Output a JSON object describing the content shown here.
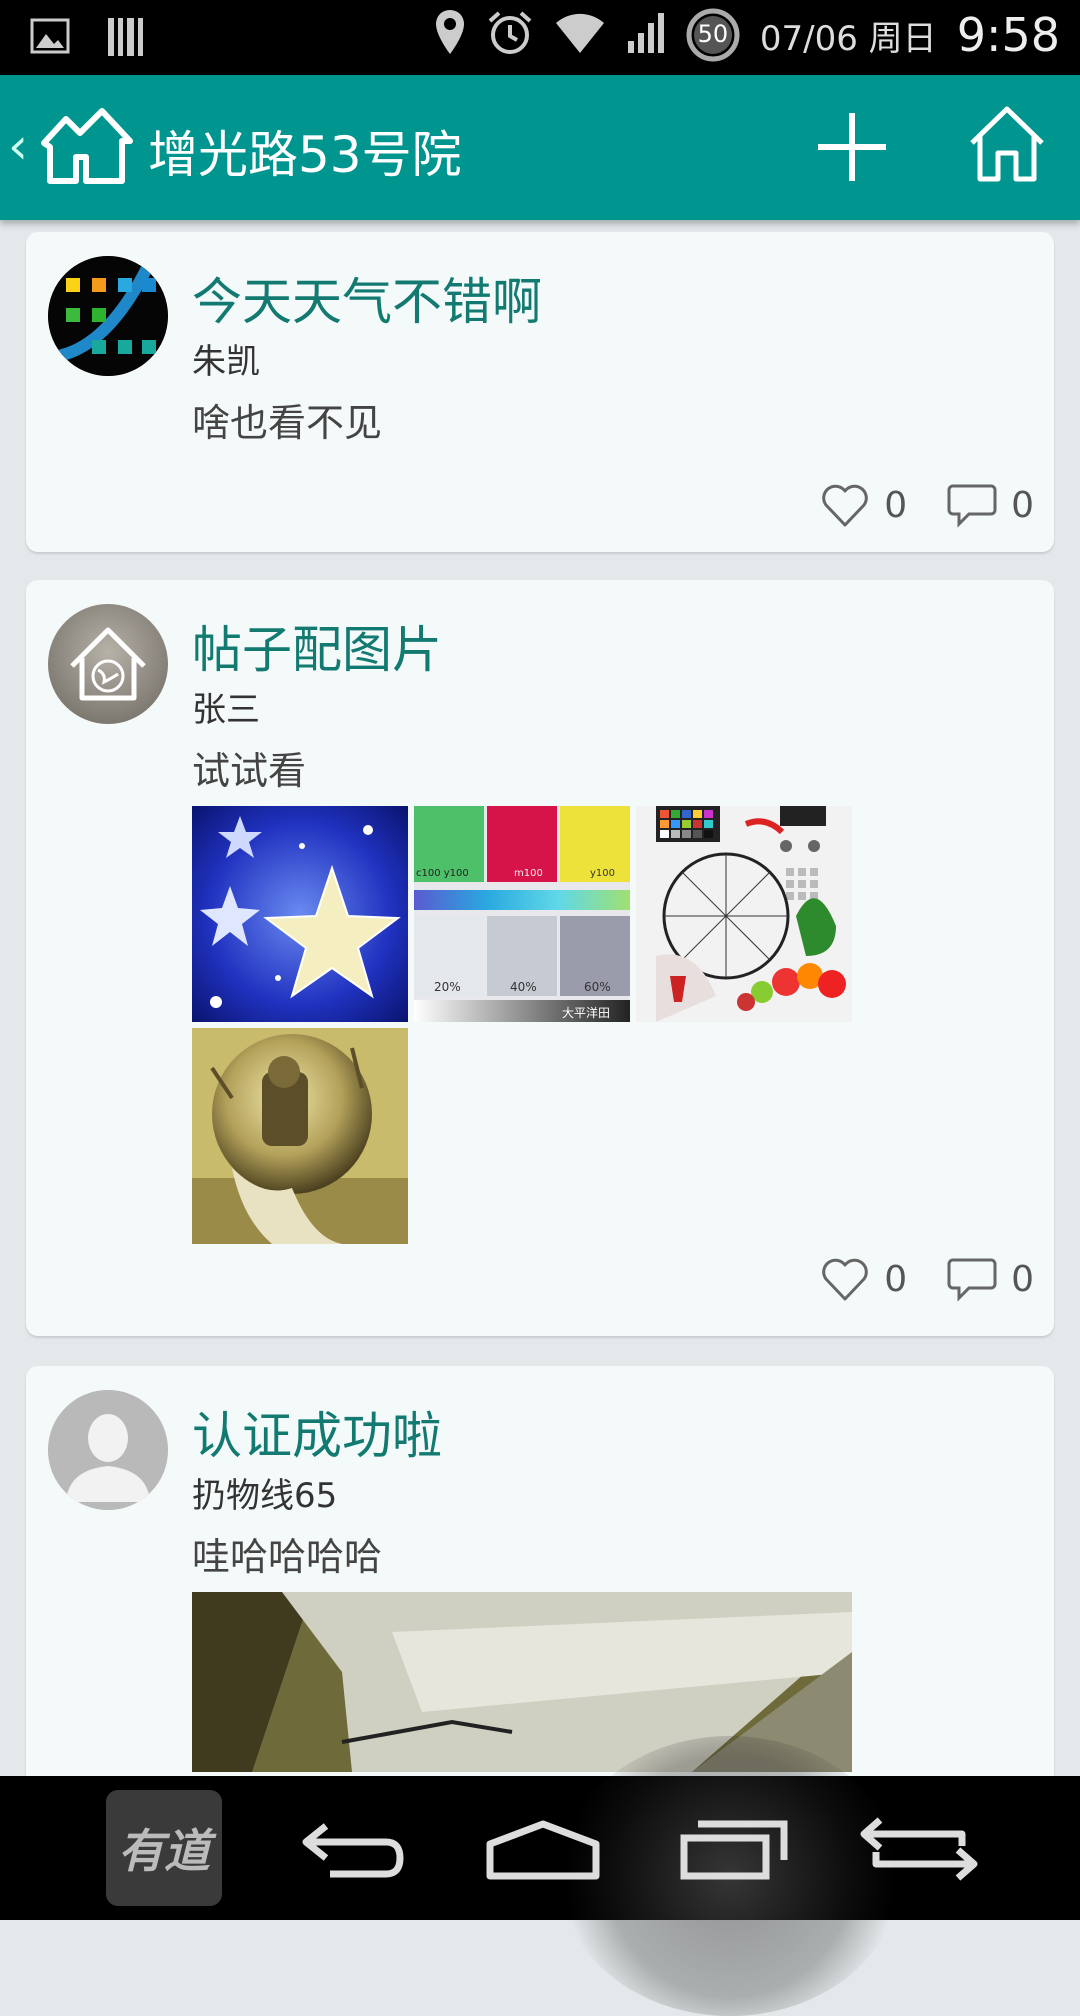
{
  "status": {
    "date": "07/06 周日",
    "time": "9:58",
    "battery": "50"
  },
  "appbar": {
    "title": "增光路53号院"
  },
  "posts": [
    {
      "title": "今天天气不错啊",
      "author": "朱凯",
      "body": "啥也看不见",
      "likes": "0",
      "comments": "0"
    },
    {
      "title": "帖子配图片",
      "author": "张三",
      "body": "试试看",
      "likes": "0",
      "comments": "0"
    },
    {
      "title": "认证成功啦",
      "author": "扔物线65",
      "body": "哇哈哈哈哈"
    }
  ],
  "colorcard": {
    "c1": "c100 y100",
    "c2": "m100",
    "c3": "y100",
    "g1": "20%",
    "g2": "40%",
    "g3": "60%",
    "brand": "大平洋田"
  },
  "navbar": {
    "youdao": "有道"
  },
  "colors": {
    "primary": "#00968f",
    "title_text": "#127a70",
    "card_bg": "#f4f9fa"
  }
}
